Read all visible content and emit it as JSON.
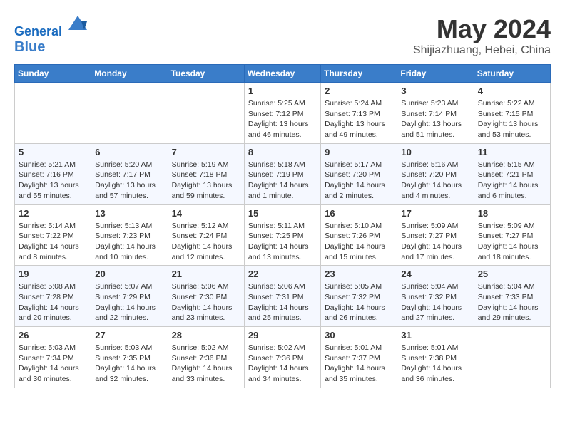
{
  "header": {
    "logo_line1": "General",
    "logo_line2": "Blue",
    "month": "May 2024",
    "location": "Shijiazhuang, Hebei, China"
  },
  "weekdays": [
    "Sunday",
    "Monday",
    "Tuesday",
    "Wednesday",
    "Thursday",
    "Friday",
    "Saturday"
  ],
  "weeks": [
    [
      {
        "day": "",
        "info": ""
      },
      {
        "day": "",
        "info": ""
      },
      {
        "day": "",
        "info": ""
      },
      {
        "day": "1",
        "info": "Sunrise: 5:25 AM\nSunset: 7:12 PM\nDaylight: 13 hours\nand 46 minutes."
      },
      {
        "day": "2",
        "info": "Sunrise: 5:24 AM\nSunset: 7:13 PM\nDaylight: 13 hours\nand 49 minutes."
      },
      {
        "day": "3",
        "info": "Sunrise: 5:23 AM\nSunset: 7:14 PM\nDaylight: 13 hours\nand 51 minutes."
      },
      {
        "day": "4",
        "info": "Sunrise: 5:22 AM\nSunset: 7:15 PM\nDaylight: 13 hours\nand 53 minutes."
      }
    ],
    [
      {
        "day": "5",
        "info": "Sunrise: 5:21 AM\nSunset: 7:16 PM\nDaylight: 13 hours\nand 55 minutes."
      },
      {
        "day": "6",
        "info": "Sunrise: 5:20 AM\nSunset: 7:17 PM\nDaylight: 13 hours\nand 57 minutes."
      },
      {
        "day": "7",
        "info": "Sunrise: 5:19 AM\nSunset: 7:18 PM\nDaylight: 13 hours\nand 59 minutes."
      },
      {
        "day": "8",
        "info": "Sunrise: 5:18 AM\nSunset: 7:19 PM\nDaylight: 14 hours\nand 1 minute."
      },
      {
        "day": "9",
        "info": "Sunrise: 5:17 AM\nSunset: 7:20 PM\nDaylight: 14 hours\nand 2 minutes."
      },
      {
        "day": "10",
        "info": "Sunrise: 5:16 AM\nSunset: 7:20 PM\nDaylight: 14 hours\nand 4 minutes."
      },
      {
        "day": "11",
        "info": "Sunrise: 5:15 AM\nSunset: 7:21 PM\nDaylight: 14 hours\nand 6 minutes."
      }
    ],
    [
      {
        "day": "12",
        "info": "Sunrise: 5:14 AM\nSunset: 7:22 PM\nDaylight: 14 hours\nand 8 minutes."
      },
      {
        "day": "13",
        "info": "Sunrise: 5:13 AM\nSunset: 7:23 PM\nDaylight: 14 hours\nand 10 minutes."
      },
      {
        "day": "14",
        "info": "Sunrise: 5:12 AM\nSunset: 7:24 PM\nDaylight: 14 hours\nand 12 minutes."
      },
      {
        "day": "15",
        "info": "Sunrise: 5:11 AM\nSunset: 7:25 PM\nDaylight: 14 hours\nand 13 minutes."
      },
      {
        "day": "16",
        "info": "Sunrise: 5:10 AM\nSunset: 7:26 PM\nDaylight: 14 hours\nand 15 minutes."
      },
      {
        "day": "17",
        "info": "Sunrise: 5:09 AM\nSunset: 7:27 PM\nDaylight: 14 hours\nand 17 minutes."
      },
      {
        "day": "18",
        "info": "Sunrise: 5:09 AM\nSunset: 7:27 PM\nDaylight: 14 hours\nand 18 minutes."
      }
    ],
    [
      {
        "day": "19",
        "info": "Sunrise: 5:08 AM\nSunset: 7:28 PM\nDaylight: 14 hours\nand 20 minutes."
      },
      {
        "day": "20",
        "info": "Sunrise: 5:07 AM\nSunset: 7:29 PM\nDaylight: 14 hours\nand 22 minutes."
      },
      {
        "day": "21",
        "info": "Sunrise: 5:06 AM\nSunset: 7:30 PM\nDaylight: 14 hours\nand 23 minutes."
      },
      {
        "day": "22",
        "info": "Sunrise: 5:06 AM\nSunset: 7:31 PM\nDaylight: 14 hours\nand 25 minutes."
      },
      {
        "day": "23",
        "info": "Sunrise: 5:05 AM\nSunset: 7:32 PM\nDaylight: 14 hours\nand 26 minutes."
      },
      {
        "day": "24",
        "info": "Sunrise: 5:04 AM\nSunset: 7:32 PM\nDaylight: 14 hours\nand 27 minutes."
      },
      {
        "day": "25",
        "info": "Sunrise: 5:04 AM\nSunset: 7:33 PM\nDaylight: 14 hours\nand 29 minutes."
      }
    ],
    [
      {
        "day": "26",
        "info": "Sunrise: 5:03 AM\nSunset: 7:34 PM\nDaylight: 14 hours\nand 30 minutes."
      },
      {
        "day": "27",
        "info": "Sunrise: 5:03 AM\nSunset: 7:35 PM\nDaylight: 14 hours\nand 32 minutes."
      },
      {
        "day": "28",
        "info": "Sunrise: 5:02 AM\nSunset: 7:36 PM\nDaylight: 14 hours\nand 33 minutes."
      },
      {
        "day": "29",
        "info": "Sunrise: 5:02 AM\nSunset: 7:36 PM\nDaylight: 14 hours\nand 34 minutes."
      },
      {
        "day": "30",
        "info": "Sunrise: 5:01 AM\nSunset: 7:37 PM\nDaylight: 14 hours\nand 35 minutes."
      },
      {
        "day": "31",
        "info": "Sunrise: 5:01 AM\nSunset: 7:38 PM\nDaylight: 14 hours\nand 36 minutes."
      },
      {
        "day": "",
        "info": ""
      }
    ]
  ]
}
